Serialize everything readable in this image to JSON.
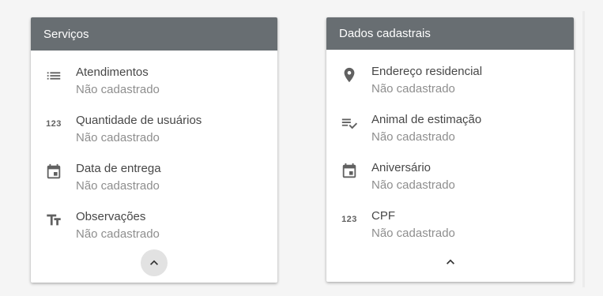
{
  "services": {
    "title": "Serviços",
    "items": [
      {
        "icon": "list-icon",
        "label": "Atendimentos",
        "value": "Não cadastrado"
      },
      {
        "icon": "numbers-icon",
        "icon_text": "123",
        "label": "Quantidade de usuários",
        "value": "Não cadastrado"
      },
      {
        "icon": "calendar-icon",
        "label": "Data de entrega",
        "value": "Não cadastrado"
      },
      {
        "icon": "text-fields-icon",
        "label": "Observações",
        "value": "Não cadastrado"
      }
    ],
    "collapse_icon": "chevron-up-icon"
  },
  "personal": {
    "title": "Dados cadastrais",
    "items": [
      {
        "icon": "location-pin-icon",
        "label": "Endereço residencial",
        "value": "Não cadastrado"
      },
      {
        "icon": "checklist-icon",
        "label": "Animal de estimação",
        "value": "Não cadastrado"
      },
      {
        "icon": "calendar-icon",
        "label": "Aniversário",
        "value": "Não cadastrado"
      },
      {
        "icon": "numbers-icon",
        "icon_text": "123",
        "label": "CPF",
        "value": "Não cadastrado"
      }
    ],
    "collapse_icon": "chevron-up-icon"
  },
  "colors": {
    "header_bg": "#686e72",
    "header_text": "#ffffff",
    "label_text": "#474747",
    "value_text": "#8e8e8e",
    "page_bg": "#f5f5f5"
  }
}
